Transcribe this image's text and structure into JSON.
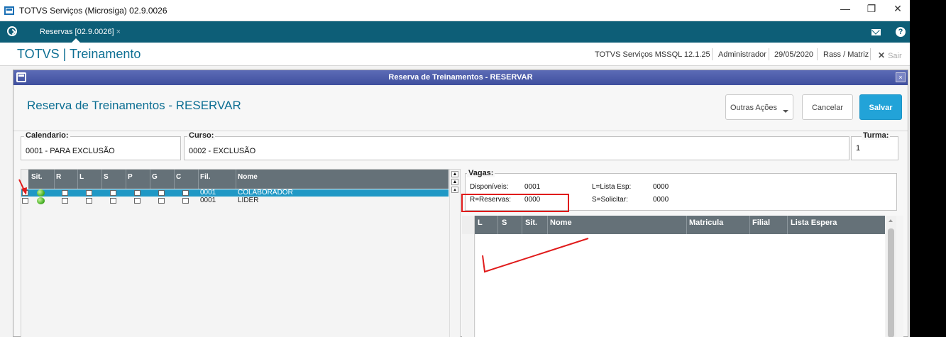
{
  "window": {
    "title": "TOTVS Serviços (Microsiga) 02.9.0026",
    "min_glyph": "—",
    "restore_glyph": "❐",
    "close_glyph": "✕"
  },
  "tabbar": {
    "tab_label": "Reservas [02.9.0026]",
    "tab_close": "×",
    "help_glyph": "?"
  },
  "header": {
    "brand": "TOTVS | Treinamento",
    "environment": "TOTVS Serviços MSSQL 12.1.25",
    "user": "Administrador",
    "date": "29/05/2020",
    "branch": "Rass / Matriz",
    "exit_glyph": "✕",
    "exit_label": "Sair"
  },
  "dialog": {
    "title": "Reserva de Treinamentos - RESERVAR",
    "close_glyph": "×",
    "heading": "Reserva de Treinamentos - RESERVAR",
    "buttons": {
      "more_actions": "Outras Ações",
      "cancel": "Cancelar",
      "save": "Salvar"
    },
    "fields": {
      "calendario": {
        "label": "Calendario:",
        "value": "0001 - PARA EXCLUSÃO"
      },
      "curso": {
        "label": "Curso:",
        "value": "0002 - EXCLUSÃO"
      },
      "turma": {
        "label": "Turma:",
        "value": "1"
      }
    },
    "left_grid": {
      "columns": [
        "Sit.",
        "R",
        "L",
        "S",
        "P",
        "G",
        "C",
        "Fil.",
        "Nome"
      ],
      "rows": [
        {
          "fil": "0001",
          "nome": "COLABORADOR",
          "selected": true
        },
        {
          "fil": "0001",
          "nome": "LIDER",
          "selected": false
        }
      ],
      "scroll_top_glyph": "▲",
      "scroll_up_glyph": "▴"
    },
    "vagas": {
      "legend": "Vagas:",
      "disponiveis_label": "Disponíveis:",
      "disponiveis_value": "0001",
      "lista_esp_label": "L=Lista Esp:",
      "lista_esp_value": "0000",
      "reservas_label": "R=Reservas:",
      "reservas_value": "0000",
      "solicitar_label": "S=Solicitar:",
      "solicitar_value": "0000"
    },
    "right_grid": {
      "columns": [
        "L",
        "S",
        "Sit.",
        "Nome",
        "Matricula",
        "Filial",
        "Lista Espera"
      ]
    }
  },
  "colors": {
    "tab_bar": "#0d5e77",
    "brand": "#0d6f93",
    "dialog_title": "#3f4f9e",
    "selected_row": "#1f98c5",
    "primary_button": "#22a3d8",
    "grid_header": "#657178",
    "annotation": "#e01b1b"
  }
}
